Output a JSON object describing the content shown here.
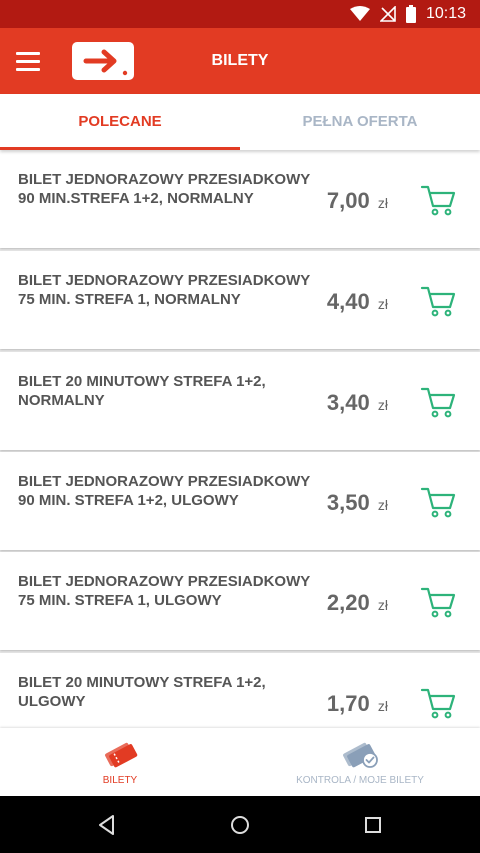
{
  "status_bar": {
    "time": "10:13",
    "icons": [
      "wifi-icon",
      "no-signal-icon",
      "battery-icon"
    ]
  },
  "app_bar": {
    "title": "BILETY",
    "icons": [
      "menu-icon",
      "app-logo-arrow-icon"
    ]
  },
  "tabs": [
    {
      "label": "POLECANE",
      "active": true
    },
    {
      "label": "PEŁNA OFERTA",
      "active": false
    }
  ],
  "tickets": [
    {
      "name": "BILET JEDNORAZOWY PRZESIADKOWY 90 MIN.STREFA 1+2, NORMALNY",
      "price": "7,00",
      "currency": "zł"
    },
    {
      "name": "BILET JEDNORAZOWY PRZESIADKOWY 75 MIN. STREFA 1, NORMALNY",
      "price": "4,40",
      "currency": "zł"
    },
    {
      "name": "BILET 20 MINUTOWY STREFA 1+2, NORMALNY",
      "price": "3,40",
      "currency": "zł"
    },
    {
      "name": "BILET JEDNORAZOWY PRZESIADKOWY 90 MIN. STREFA 1+2, ULGOWY",
      "price": "3,50",
      "currency": "zł"
    },
    {
      "name": "BILET JEDNORAZOWY PRZESIADKOWY 75 MIN. STREFA 1, ULGOWY",
      "price": "2,20",
      "currency": "zł"
    },
    {
      "name": "BILET 20 MINUTOWY STREFA 1+2, ULGOWY",
      "price": "1,70",
      "currency": "zł"
    }
  ],
  "bottom_nav": [
    {
      "label": "BILETY",
      "active": true,
      "icon": "tickets-icon"
    },
    {
      "label": "KONTROLA / MOJE BILETY",
      "active": false,
      "icon": "ticket-check-icon"
    }
  ],
  "system_nav": [
    "back-icon",
    "home-icon",
    "recents-icon"
  ],
  "colors": {
    "primary": "#e23b23",
    "status_bar": "#b21a12",
    "cart": "#2db37a",
    "inactive_tab": "#a9b6c6"
  }
}
